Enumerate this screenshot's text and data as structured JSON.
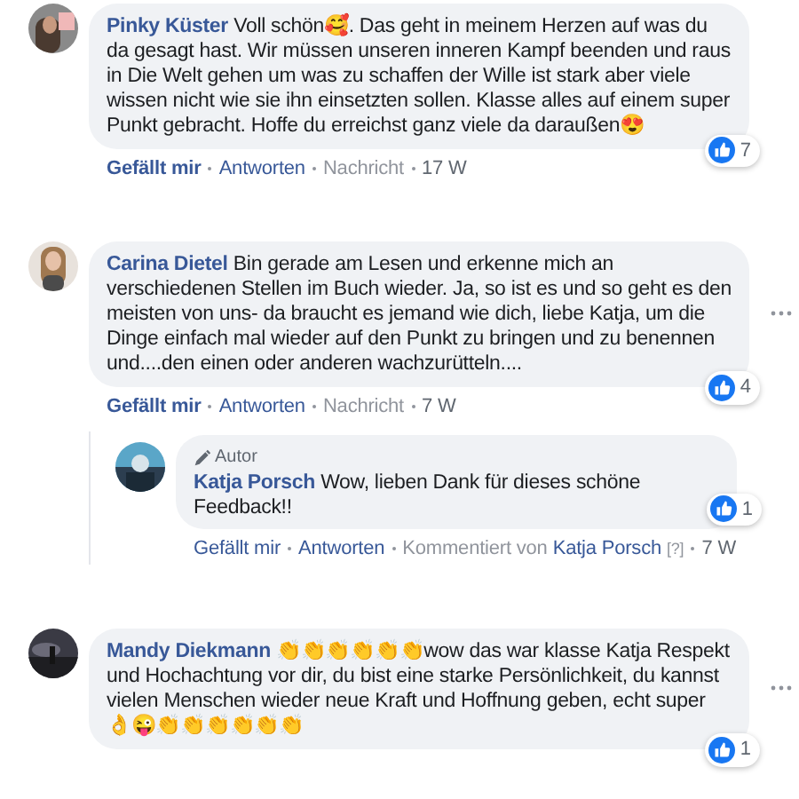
{
  "comments": [
    {
      "author": "Pinky Küster",
      "text": "Voll schön🥰. Das geht in meinem Herzen auf was du da gesagt hast. Wir müssen unseren inneren Kampf beenden und raus in Die Welt gehen um was zu schaffen der Wille ist stark aber viele wissen nicht wie sie ihn einsetzten sollen. Klasse alles auf einem super Punkt gebracht. Hoffe du erreichst ganz viele da daraußen😍",
      "reactions": "7",
      "more_menu": false,
      "actions": [
        {
          "text": "Gefällt mir",
          "kind": "strong"
        },
        {
          "text": "Antworten",
          "kind": "link"
        },
        {
          "text": "Nachricht",
          "kind": "plain"
        },
        {
          "text": "17 W",
          "kind": "time"
        }
      ]
    },
    {
      "author": "Carina Dietel",
      "text": "Bin gerade am Lesen und erkenne mich an verschiedenen Stellen im Buch wieder. Ja, so ist es und so geht es den meisten von uns- da braucht es jemand wie dich, liebe Katja, um die Dinge einfach mal wieder auf den Punkt zu bringen und zu benennen und....den einen oder anderen wachzurütteln....",
      "reactions": "4",
      "more_menu": true,
      "actions": [
        {
          "text": "Gefällt mir",
          "kind": "strong"
        },
        {
          "text": "Antworten",
          "kind": "link"
        },
        {
          "text": "Nachricht",
          "kind": "plain"
        },
        {
          "text": "7 W",
          "kind": "time"
        }
      ],
      "replies": [
        {
          "badge": "Autor",
          "author": "Katja Porsch",
          "text": "Wow, lieben Dank für dieses schöne Feedback!!",
          "reactions": "1",
          "actions": [
            {
              "text": "Gefällt mir",
              "kind": "link"
            },
            {
              "text": "Antworten",
              "kind": "link"
            },
            {
              "text": "Kommentiert von",
              "kind": "plain",
              "follow": [
                {
                  "text": "Katja Porsch",
                  "kind": "link"
                },
                {
                  "text": "[?]",
                  "kind": "help"
                }
              ]
            },
            {
              "text": "7 W",
              "kind": "time"
            }
          ]
        }
      ]
    },
    {
      "author": "Mandy Diekmann",
      "text": "👏👏👏👏👏👏wow das war klasse Katja Respekt und Hochachtung vor dir, du bist eine starke Persönlichkeit, du kannst vielen Menschen wieder neue Kraft und Hoffnung geben, echt super 👌😜👏👏👏👏👏👏",
      "reactions": "1",
      "more_menu": true
    }
  ]
}
